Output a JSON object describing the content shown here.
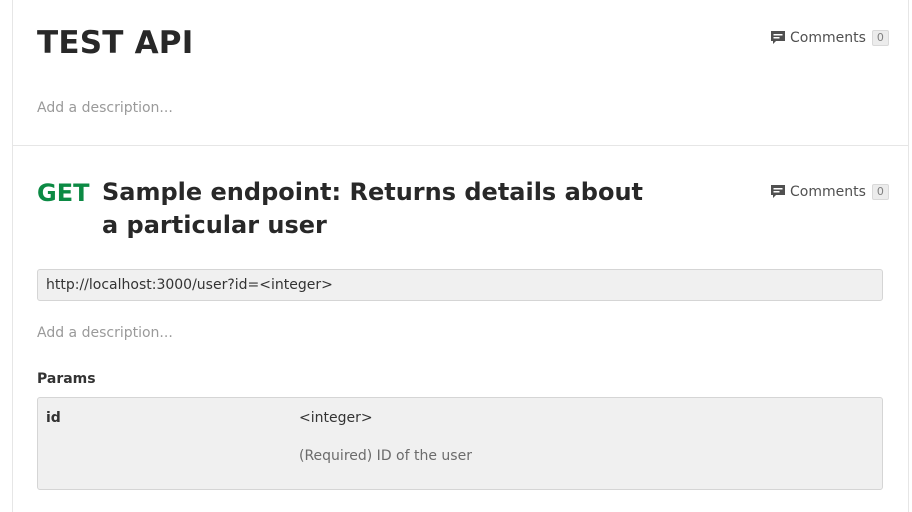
{
  "collection": {
    "title": "TEST API",
    "description_placeholder": "Add a description...",
    "comments": {
      "label": "Comments",
      "count": "0",
      "icon": "comment-icon"
    }
  },
  "request": {
    "method": "GET",
    "method_color": "#0c8a44",
    "name": "Sample endpoint: Returns details about a particular user",
    "url": "http://localhost:3000/user?id=<integer>",
    "description_placeholder": "Add a description...",
    "comments": {
      "label": "Comments",
      "count": "0",
      "icon": "comment-icon"
    },
    "params": {
      "heading": "Params",
      "rows": [
        {
          "key": "id",
          "type": "<integer>",
          "description": "(Required) ID of the user"
        }
      ]
    }
  }
}
